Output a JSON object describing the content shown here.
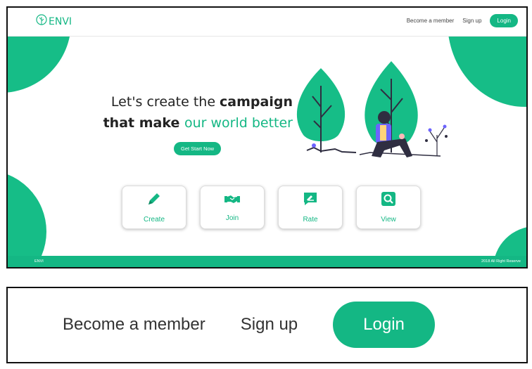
{
  "brand": {
    "name": "ENVI"
  },
  "nav": {
    "become_member": "Become a member",
    "sign_up": "Sign up",
    "login": "Login"
  },
  "hero": {
    "line1_prefix": "Let's create the ",
    "line1_bold": "campaign",
    "line2_bold": "that make ",
    "line2_accent": "our world better",
    "cta": "Get Start Now"
  },
  "actions": [
    {
      "label": "Create",
      "icon": "pencil-icon"
    },
    {
      "label": "Join",
      "icon": "handshake-icon"
    },
    {
      "label": "Rate",
      "icon": "rate-icon"
    },
    {
      "label": "View",
      "icon": "search-icon"
    }
  ],
  "footer": {
    "left": "ENVI",
    "right": "2018 All Right Reserve"
  },
  "zoom": {
    "become_member": "Become a member",
    "sign_up": "Sign up",
    "login": "Login"
  },
  "colors": {
    "accent": "#14b784",
    "blob": "#16bd87",
    "figure_dark": "#2f2e41",
    "figure_shirt": "#6c63ff"
  }
}
